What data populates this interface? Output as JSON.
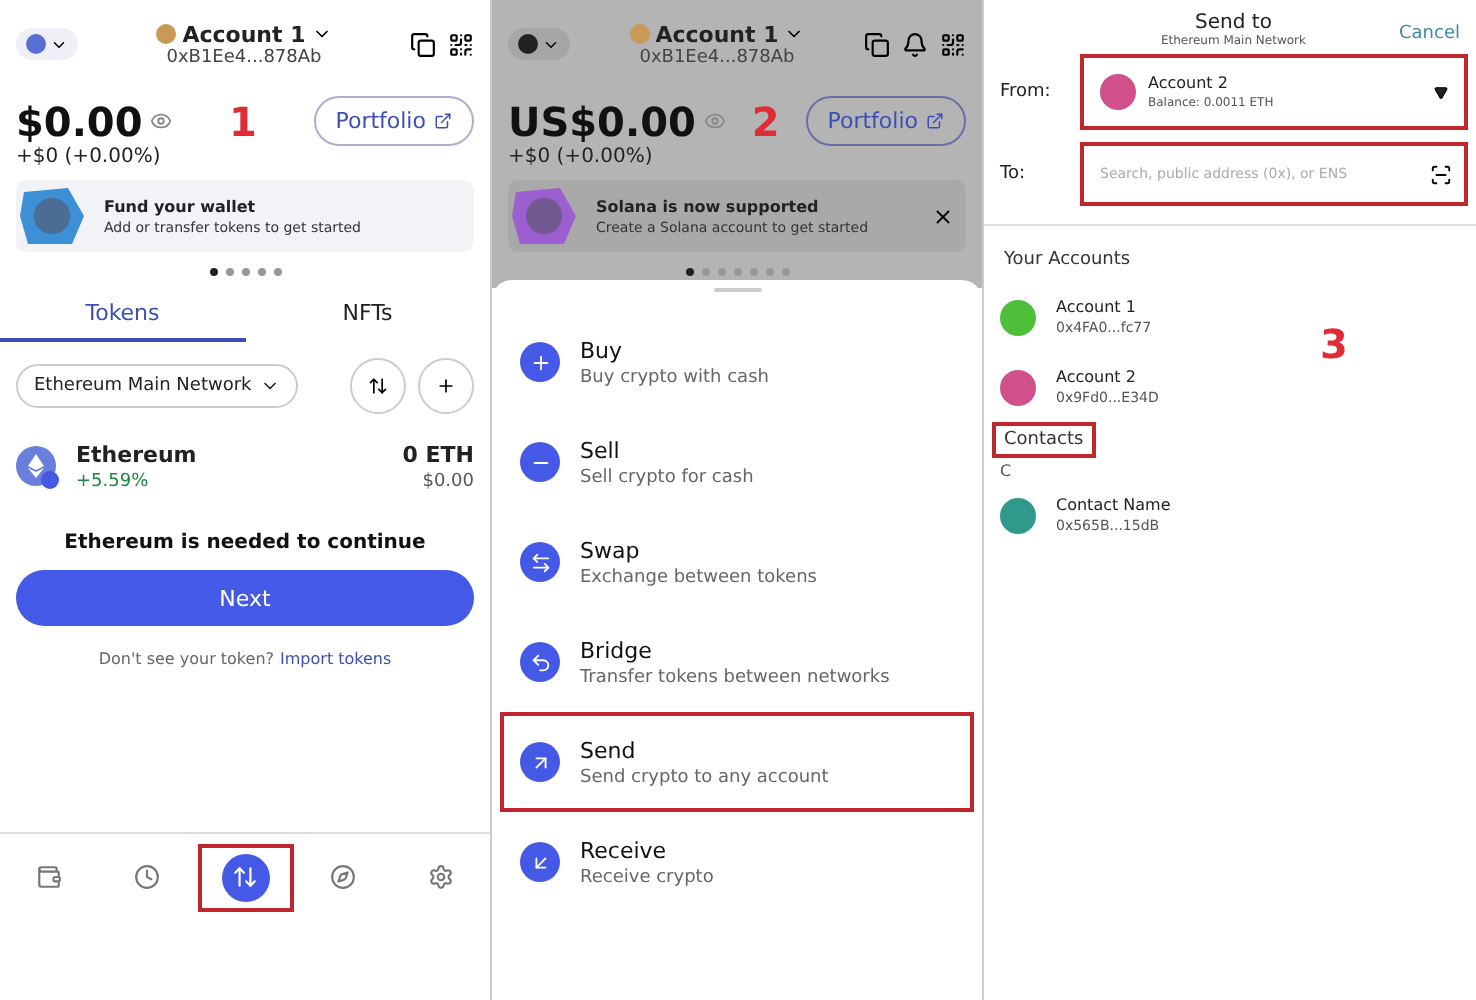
{
  "panels": [
    {
      "step": "1",
      "header": {
        "account": "Account 1",
        "address": "0xB1Ee4...878Ab",
        "bell": false
      },
      "balance": "$0.00",
      "change": "+$0 (+0.00%)",
      "portfolio": "Portfolio",
      "banner": {
        "title": "Fund your wallet",
        "text": "Add or transfer tokens to get started",
        "closable": false,
        "color": "#3d8fd6"
      },
      "dots": [
        {
          "selected": true
        },
        {
          "selected": false
        },
        {
          "selected": false
        },
        {
          "selected": false
        },
        {
          "selected": false
        }
      ],
      "tabs": [
        {
          "label": "Tokens",
          "selected": true
        },
        {
          "label": "NFTs",
          "selected": false
        }
      ],
      "network_filter": "Ethereum Main Network",
      "token": {
        "name": "Ethereum",
        "change": "+5.59%",
        "amount": "0 ETH",
        "value": "$0.00"
      },
      "notice": "Ethereum is needed to continue",
      "next": "Next",
      "import_prefix": "Don't see your token?",
      "import_link": "Import tokens",
      "nav": [
        {
          "kind": "wallet",
          "selected": false,
          "highlighted": false
        },
        {
          "kind": "activity",
          "selected": false,
          "highlighted": false
        },
        {
          "kind": "trade",
          "selected": true,
          "highlighted": true
        },
        {
          "kind": "explore",
          "selected": false,
          "highlighted": false
        },
        {
          "kind": "settings",
          "selected": false,
          "highlighted": false
        }
      ]
    },
    {
      "step": "2",
      "header": {
        "account": "Account 1",
        "address": "0xB1Ee4...878Ab",
        "bell": true
      },
      "balance": "US$0.00",
      "change": "+$0 (+0.00%)",
      "portfolio": "Portfolio",
      "banner": {
        "title": "Solana is now supported",
        "text": "Create a Solana account to get started",
        "closable": true,
        "color": "#9b5fd0"
      },
      "dots": [
        {
          "selected": true
        },
        {
          "selected": false
        },
        {
          "selected": false
        },
        {
          "selected": false
        },
        {
          "selected": false
        },
        {
          "selected": false
        },
        {
          "selected": false
        }
      ],
      "actions": [
        {
          "kind": "buy",
          "title": "Buy",
          "text": "Buy crypto with cash",
          "highlighted": false
        },
        {
          "kind": "sell",
          "title": "Sell",
          "text": "Sell crypto for cash",
          "highlighted": false
        },
        {
          "kind": "swap",
          "title": "Swap",
          "text": "Exchange between tokens",
          "highlighted": false
        },
        {
          "kind": "bridge",
          "title": "Bridge",
          "text": "Transfer tokens between networks",
          "highlighted": false
        },
        {
          "kind": "send",
          "title": "Send",
          "text": "Send crypto to any account",
          "highlighted": true
        },
        {
          "kind": "receive",
          "title": "Receive",
          "text": "Receive crypto",
          "highlighted": false
        }
      ]
    },
    {
      "step": "3",
      "title": "Send to",
      "network": "Ethereum Main Network",
      "cancel": "Cancel",
      "from": {
        "label": "From:",
        "account": "Account 2",
        "balance": "Balance: 0.0011 ETH",
        "color": "#d0508a",
        "highlighted": true
      },
      "to": {
        "label": "To:",
        "placeholder": "Search, public address (0x), or ENS",
        "highlighted": true
      },
      "accounts_heading": "Your Accounts",
      "accounts": [
        {
          "name": "Account 1",
          "address": "0x4FA0...fc77",
          "color": "#4fbf3a"
        },
        {
          "name": "Account 2",
          "address": "0x9Fd0...E34D",
          "color": "#d0508a"
        }
      ],
      "contacts_heading": {
        "label": "Contacts",
        "highlighted": true
      },
      "contacts_letter": "C",
      "contacts": [
        {
          "name": "Contact Name",
          "address": "0x565B...15dB",
          "color": "#2f9a8c"
        }
      ]
    }
  ]
}
